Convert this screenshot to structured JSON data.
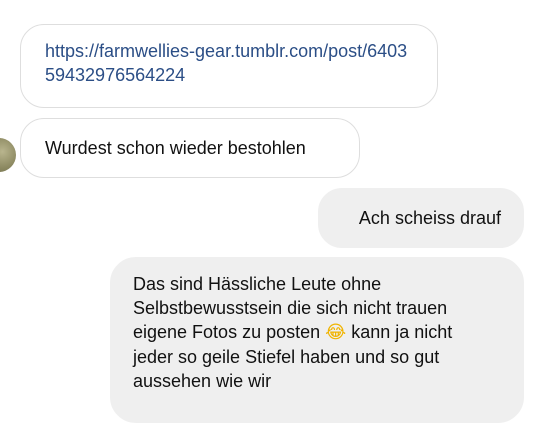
{
  "messages": [
    {
      "direction": "incoming",
      "link_text": "https://farmwellies-gear.tumblr.com/post/640359432976564224"
    },
    {
      "direction": "incoming",
      "text": "Wurdest schon wieder bestohlen"
    },
    {
      "direction": "outgoing",
      "text": "Ach scheiss drauf"
    },
    {
      "direction": "outgoing",
      "text_before_emoji": "Das sind Hässliche Leute ohne\nSelbstbewusstsein die sich nicht trauen\neigene Fotos zu posten ",
      "emoji": "😂",
      "text_after_emoji": " kann ja nicht\njeder so geile Stiefel haben und so gut\naussehen wie wir"
    }
  ],
  "colors": {
    "link": "#2b4e86",
    "outgoing_bubble": "#efefef",
    "incoming_border": "#dedede"
  },
  "icons": {
    "avatar": "contact-avatar"
  }
}
